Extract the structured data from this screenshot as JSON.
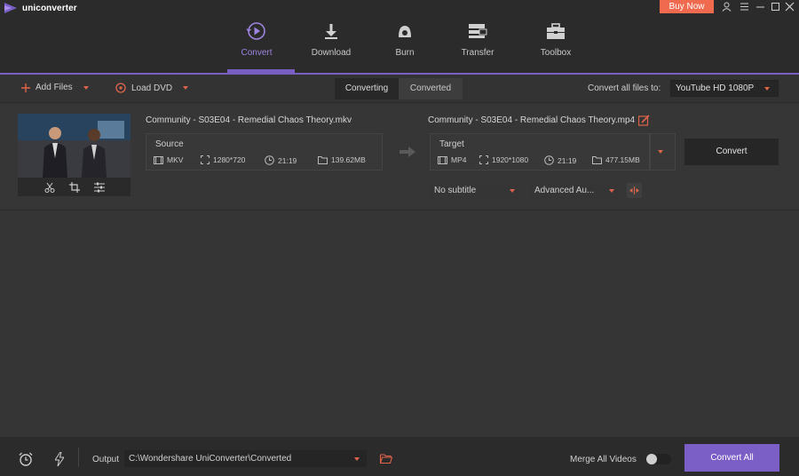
{
  "app": {
    "name": "uniconverter",
    "buy_now": "Buy Now"
  },
  "colors": {
    "accent": "#7a5fc2",
    "buy_now": "#f06a50",
    "caret": "#e0644a",
    "background": "#353535"
  },
  "nav": [
    {
      "label": "Convert",
      "icon": "convert-icon",
      "active": true
    },
    {
      "label": "Download",
      "icon": "download-icon",
      "active": false
    },
    {
      "label": "Burn",
      "icon": "burn-icon",
      "active": false
    },
    {
      "label": "Transfer",
      "icon": "transfer-icon",
      "active": false
    },
    {
      "label": "Toolbox",
      "icon": "toolbox-icon",
      "active": false
    }
  ],
  "toolbar": {
    "add_files": "Add Files",
    "load_dvd": "Load DVD",
    "tab_converting": "Converting",
    "tab_converted": "Converted",
    "convert_all_to_label": "Convert all files to:",
    "preset": "YouTube HD 1080P"
  },
  "file": {
    "source_name": "Community - S03E04 - Remedial Chaos Theory.mkv",
    "target_name": "Community - S03E04 - Remedial Chaos Theory.mp4",
    "source": {
      "label": "Source",
      "format": "MKV",
      "resolution": "1280*720",
      "duration": "21:19",
      "size": "139.62MB"
    },
    "target": {
      "label": "Target",
      "format": "MP4",
      "resolution": "1920*1080",
      "duration": "21:19",
      "size": "477.15MB"
    },
    "subtitle": "No subtitle",
    "audio": "Advanced Au...",
    "convert_button": "Convert"
  },
  "bottom": {
    "output_label": "Output",
    "output_path": "C:\\Wondershare UniConverter\\Converted",
    "merge_label": "Merge All Videos",
    "merge_enabled": false,
    "convert_all": "Convert All"
  }
}
